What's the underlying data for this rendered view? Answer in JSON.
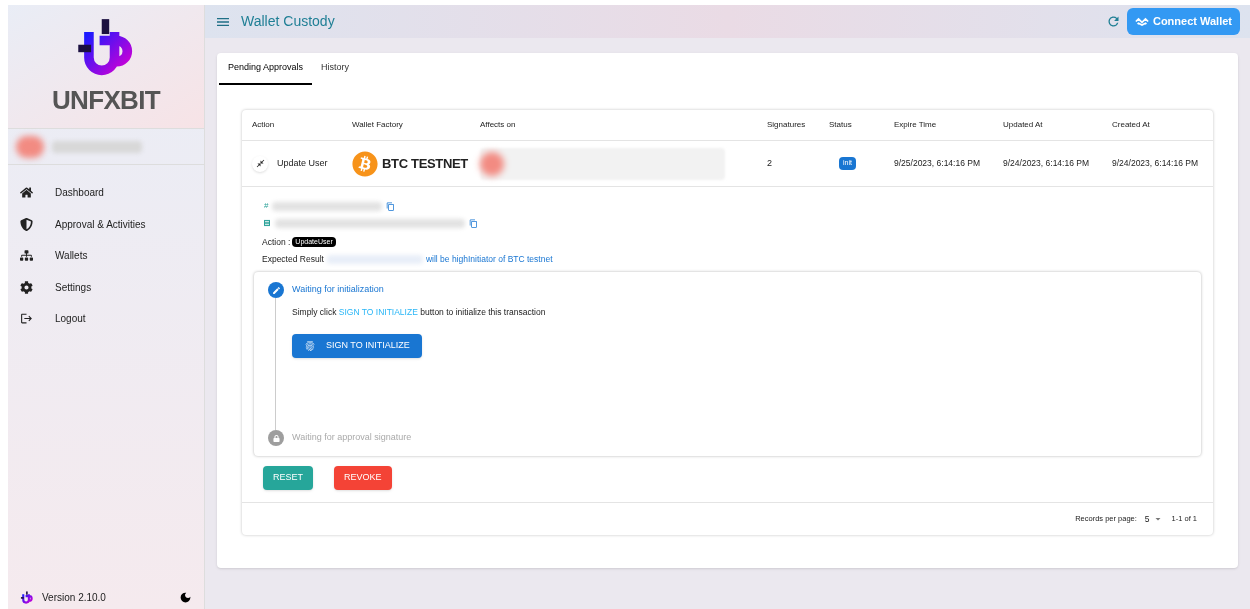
{
  "sidebar": {
    "brand": "UNFXBIT",
    "items": [
      {
        "label": "Dashboard"
      },
      {
        "label": "Approval & Activities"
      },
      {
        "label": "Wallets"
      },
      {
        "label": "Settings"
      },
      {
        "label": "Logout"
      }
    ],
    "version": "Version 2.10.0"
  },
  "header": {
    "title": "Wallet Custody",
    "connect_button": "Connect Wallet"
  },
  "tabs": [
    {
      "label": "Pending Approvals",
      "selected": true
    },
    {
      "label": "History",
      "selected": false
    }
  ],
  "table": {
    "columns": [
      "Action",
      "Wallet Factory",
      "Affects on",
      "Signatures",
      "Status",
      "Expire Time",
      "Updated At",
      "Created At"
    ],
    "rows": [
      {
        "action": "Update User",
        "wallet_factory": "BTC TESTNET",
        "signatures": "2",
        "status": "init",
        "expire_time": "9/25/2023, 6:14:16 PM",
        "updated_at": "9/24/2023, 6:14:16 PM",
        "created_at": "9/24/2023, 6:14:16 PM",
        "expanded": true
      }
    ]
  },
  "details": {
    "hash_mark": "#",
    "action_label": "Action :",
    "action_tag": "UpdateUser",
    "expected_label": "Expected Result",
    "expected_text": "will be highInitiator of BTC testnet"
  },
  "steps": [
    {
      "title": "Waiting for initialization",
      "active": true,
      "text_before": "Simply click",
      "text_link": "SIGN TO INITIALIZE",
      "text_after": "button to initialize this transaction",
      "button": "SIGN TO INITIALIZE"
    },
    {
      "title": "Waiting for approval signature",
      "active": false
    }
  ],
  "actions": [
    "RESET",
    "REVOKE"
  ],
  "pagination": {
    "label": "Records per page:",
    "per_page": "5",
    "range": "1-1 of 1"
  }
}
